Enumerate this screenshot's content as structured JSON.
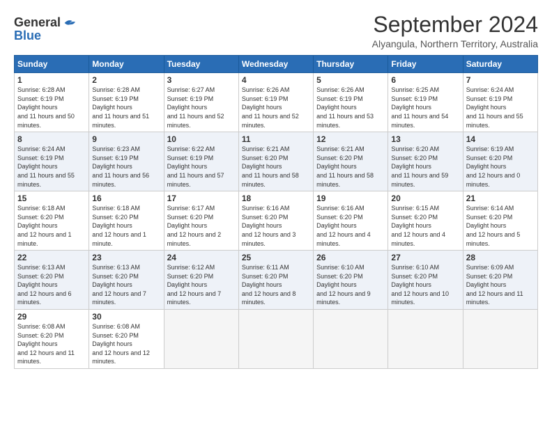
{
  "logo": {
    "general": "General",
    "blue": "Blue"
  },
  "title": "September 2024",
  "subtitle": "Alyangula, Northern Territory, Australia",
  "days": [
    "Sunday",
    "Monday",
    "Tuesday",
    "Wednesday",
    "Thursday",
    "Friday",
    "Saturday"
  ],
  "weeks": [
    [
      {
        "day": "1",
        "sunrise": "6:28 AM",
        "sunset": "6:19 PM",
        "daylight": "11 hours and 50 minutes."
      },
      {
        "day": "2",
        "sunrise": "6:28 AM",
        "sunset": "6:19 PM",
        "daylight": "11 hours and 51 minutes."
      },
      {
        "day": "3",
        "sunrise": "6:27 AM",
        "sunset": "6:19 PM",
        "daylight": "11 hours and 52 minutes."
      },
      {
        "day": "4",
        "sunrise": "6:26 AM",
        "sunset": "6:19 PM",
        "daylight": "11 hours and 52 minutes."
      },
      {
        "day": "5",
        "sunrise": "6:26 AM",
        "sunset": "6:19 PM",
        "daylight": "11 hours and 53 minutes."
      },
      {
        "day": "6",
        "sunrise": "6:25 AM",
        "sunset": "6:19 PM",
        "daylight": "11 hours and 54 minutes."
      },
      {
        "day": "7",
        "sunrise": "6:24 AM",
        "sunset": "6:19 PM",
        "daylight": "11 hours and 55 minutes."
      }
    ],
    [
      {
        "day": "8",
        "sunrise": "6:24 AM",
        "sunset": "6:19 PM",
        "daylight": "11 hours and 55 minutes."
      },
      {
        "day": "9",
        "sunrise": "6:23 AM",
        "sunset": "6:19 PM",
        "daylight": "11 hours and 56 minutes."
      },
      {
        "day": "10",
        "sunrise": "6:22 AM",
        "sunset": "6:19 PM",
        "daylight": "11 hours and 57 minutes."
      },
      {
        "day": "11",
        "sunrise": "6:21 AM",
        "sunset": "6:20 PM",
        "daylight": "11 hours and 58 minutes."
      },
      {
        "day": "12",
        "sunrise": "6:21 AM",
        "sunset": "6:20 PM",
        "daylight": "11 hours and 58 minutes."
      },
      {
        "day": "13",
        "sunrise": "6:20 AM",
        "sunset": "6:20 PM",
        "daylight": "11 hours and 59 minutes."
      },
      {
        "day": "14",
        "sunrise": "6:19 AM",
        "sunset": "6:20 PM",
        "daylight": "12 hours and 0 minutes."
      }
    ],
    [
      {
        "day": "15",
        "sunrise": "6:18 AM",
        "sunset": "6:20 PM",
        "daylight": "12 hours and 1 minute."
      },
      {
        "day": "16",
        "sunrise": "6:18 AM",
        "sunset": "6:20 PM",
        "daylight": "12 hours and 1 minute."
      },
      {
        "day": "17",
        "sunrise": "6:17 AM",
        "sunset": "6:20 PM",
        "daylight": "12 hours and 2 minutes."
      },
      {
        "day": "18",
        "sunrise": "6:16 AM",
        "sunset": "6:20 PM",
        "daylight": "12 hours and 3 minutes."
      },
      {
        "day": "19",
        "sunrise": "6:16 AM",
        "sunset": "6:20 PM",
        "daylight": "12 hours and 4 minutes."
      },
      {
        "day": "20",
        "sunrise": "6:15 AM",
        "sunset": "6:20 PM",
        "daylight": "12 hours and 4 minutes."
      },
      {
        "day": "21",
        "sunrise": "6:14 AM",
        "sunset": "6:20 PM",
        "daylight": "12 hours and 5 minutes."
      }
    ],
    [
      {
        "day": "22",
        "sunrise": "6:13 AM",
        "sunset": "6:20 PM",
        "daylight": "12 hours and 6 minutes."
      },
      {
        "day": "23",
        "sunrise": "6:13 AM",
        "sunset": "6:20 PM",
        "daylight": "12 hours and 7 minutes."
      },
      {
        "day": "24",
        "sunrise": "6:12 AM",
        "sunset": "6:20 PM",
        "daylight": "12 hours and 7 minutes."
      },
      {
        "day": "25",
        "sunrise": "6:11 AM",
        "sunset": "6:20 PM",
        "daylight": "12 hours and 8 minutes."
      },
      {
        "day": "26",
        "sunrise": "6:10 AM",
        "sunset": "6:20 PM",
        "daylight": "12 hours and 9 minutes."
      },
      {
        "day": "27",
        "sunrise": "6:10 AM",
        "sunset": "6:20 PM",
        "daylight": "12 hours and 10 minutes."
      },
      {
        "day": "28",
        "sunrise": "6:09 AM",
        "sunset": "6:20 PM",
        "daylight": "12 hours and 11 minutes."
      }
    ],
    [
      {
        "day": "29",
        "sunrise": "6:08 AM",
        "sunset": "6:20 PM",
        "daylight": "12 hours and 11 minutes."
      },
      {
        "day": "30",
        "sunrise": "6:08 AM",
        "sunset": "6:20 PM",
        "daylight": "12 hours and 12 minutes."
      },
      null,
      null,
      null,
      null,
      null
    ]
  ]
}
